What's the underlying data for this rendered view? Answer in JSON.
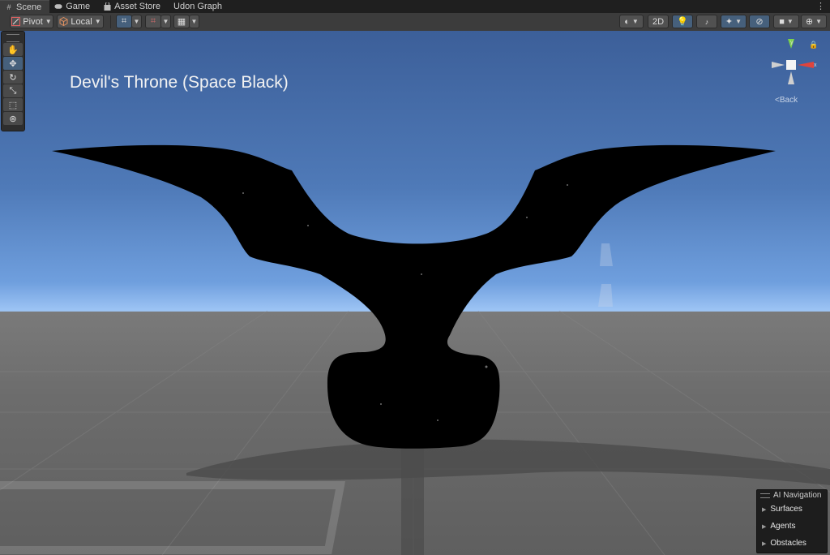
{
  "tabs": [
    {
      "label": "Scene",
      "icon": "grid-icon"
    },
    {
      "label": "Game",
      "icon": "gamepad-icon"
    },
    {
      "label": "Asset Store",
      "icon": "shopping-bag-icon"
    },
    {
      "label": "Udon Graph",
      "icon": ""
    }
  ],
  "toolbar": {
    "pivot_label": "Pivot",
    "local_label": "Local",
    "twod_label": "2D"
  },
  "scene": {
    "title": "Devil's Throne (Space Black)"
  },
  "gizmo": {
    "y_label": "y",
    "x_label": "x",
    "view_label": "Back"
  },
  "ai_navigation": {
    "title": "AI Navigation",
    "items": [
      "Surfaces",
      "Agents",
      "Obstacles"
    ]
  },
  "colors": {
    "sky_top": "#3c5f99",
    "horizon": "#9ec5f5",
    "ground": "#6c6c6c",
    "object": "#000000",
    "axis_x": "#e0443c",
    "axis_y": "#7bd24a"
  }
}
